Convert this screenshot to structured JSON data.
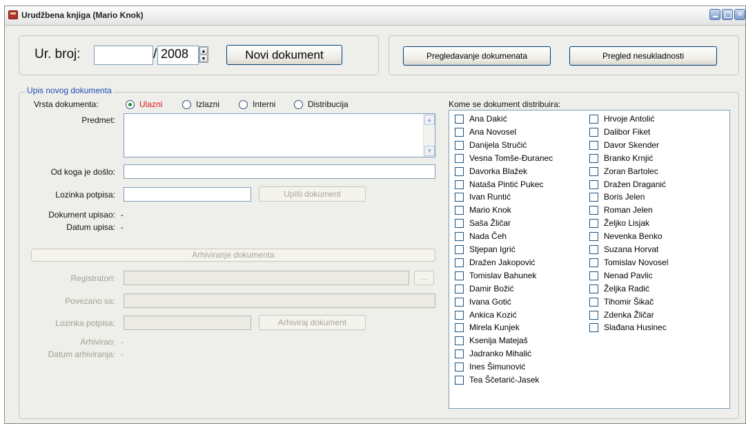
{
  "window": {
    "title": "Urudžbena knjiga (Mario Knok)"
  },
  "header": {
    "ur_broj_label": "Ur. broj:",
    "ur_broj_value": "",
    "slash": "/",
    "year": "2008",
    "novi_dokument": "Novi dokument",
    "pregledavanje": "Pregledavanje dokumenata",
    "pregled_nesukladnosti": "Pregled nesukladnosti"
  },
  "form": {
    "group_title": "Upis novog dokumenta",
    "vrsta_label": "Vrsta dokumenta:",
    "vrsta_options": [
      "Ulazni",
      "Izlazni",
      "Interni",
      "Distribucija"
    ],
    "vrsta_selected": "Ulazni",
    "predmet_label": "Predmet:",
    "predmet_value": "",
    "od_koga_label": "Od koga je došlo:",
    "od_koga_value": "",
    "lozinka_label": "Lozinka potpisa:",
    "lozinka_value": "",
    "upisi_button": "Upiši dokument",
    "upisao_label": "Dokument upisao:",
    "upisao_value": "-",
    "datum_upisa_label": "Datum upisa:",
    "datum_upisa_value": "-"
  },
  "archive": {
    "bar_label": "Arhiviranje dokumenta",
    "registratori_label": "Registratori:",
    "browse_button": "...",
    "povezano_label": "Povezano sa:",
    "lozinka_label": "Lozinka potpisa:",
    "arhiviraj_button": "Arhiviraj dokument",
    "arhivirao_label": "Arhivirao:",
    "arhivirao_value": "-",
    "datum_arhiviranja_label": "Datum arhiviranja:",
    "datum_arhiviranja_value": "-"
  },
  "distribution": {
    "label": "Kome se dokument distribuira:",
    "column1": [
      "Ana Dakić",
      "Ana Novosel",
      "Danijela Stručić",
      "Vesna Tomše-Đuranec",
      "Davorka Blažek",
      "Nataša Pintić Pukec",
      "Ivan Runtić",
      "Mario Knok",
      "Saša Žličar",
      "Nada Čeh",
      "Stjepan Igrić",
      "Dražen Jakopović",
      "Tomislav Bahunek",
      "Damir Božić",
      "Ivana Gotić",
      "Ankica Kozić",
      "Mirela Kunjek",
      "Ksenija Matejaš",
      "Jadranko Mihalić",
      "Ines Šimunović",
      "Tea Ščetarić-Jasek"
    ],
    "column2": [
      "Hrvoje Antolić",
      "Dalibor Fiket",
      "Davor Skender",
      "Branko Krnjić",
      "Zoran Bartolec",
      "Dražen Draganić",
      "Boris Jelen",
      "Roman Jelen",
      "Željko Lisjak",
      "Nevenka Benko",
      "Suzana Horvat",
      "Tomislav Novosel",
      "Nenad Pavlic",
      "Željka Radić",
      "Tihomir Šikač",
      "Zdenka Žličar",
      "Slađana Husinec"
    ]
  }
}
